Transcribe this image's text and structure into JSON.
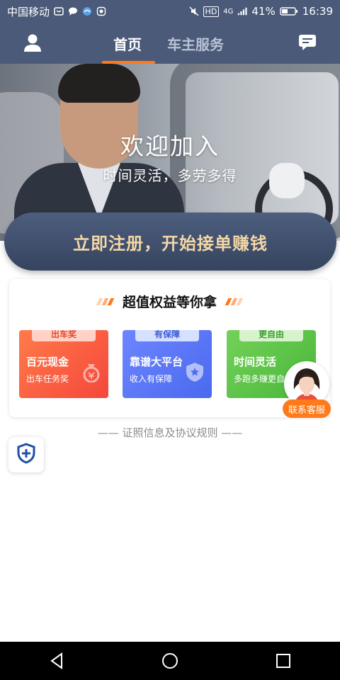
{
  "status_bar": {
    "carrier": "中国移动",
    "network": "4G",
    "hd": "HD",
    "battery": "41%",
    "time": "16:39",
    "icons": [
      "wechat-icon",
      "chat-bubble-icon",
      "bird-icon",
      "camera-icon",
      "mute-icon",
      "signal-icon",
      "battery-icon"
    ]
  },
  "header": {
    "tabs": [
      {
        "label": "首页",
        "active": true
      },
      {
        "label": "车主服务",
        "active": false
      }
    ],
    "left_icon": "user-icon",
    "right_icon": "message-icon",
    "accent_color": "#ff7a1a"
  },
  "hero": {
    "title": "欢迎加入",
    "subtitle": "时间灵活，多劳多得"
  },
  "register_button": {
    "label": "立即注册，开始接单赚钱"
  },
  "benefits": {
    "title": "超值权益等你拿",
    "items": [
      {
        "tag": "出车奖",
        "title": "百元现金",
        "subtitle": "出车任务奖",
        "icon": "money-bag-icon"
      },
      {
        "tag": "有保障",
        "title": "靠谱大平台",
        "subtitle": "收入有保障",
        "icon": "shield-star-icon"
      },
      {
        "tag": "更自由",
        "title": "时间灵活",
        "subtitle": "多跑多赚更自由",
        "icon": "clock-icon"
      }
    ]
  },
  "customer_service": {
    "label": "联系客服"
  },
  "footer": {
    "cert_link": "—— 证照信息及协议规则 ——"
  },
  "nav_bar": {
    "buttons": [
      "back-icon",
      "home-icon",
      "recent-apps-icon"
    ]
  }
}
